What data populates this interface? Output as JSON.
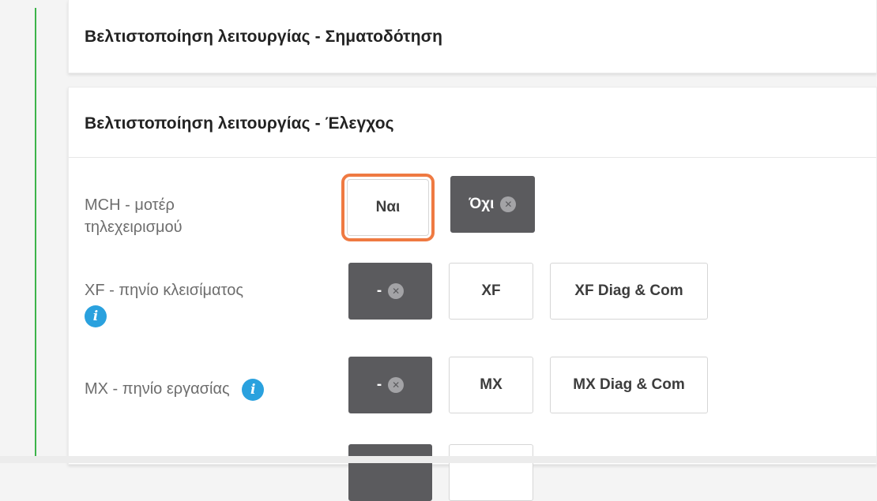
{
  "sections": {
    "signaling": {
      "title": "Βελτιστοποίηση λειτουργίας - Σηματοδότηση"
    },
    "control": {
      "title": "Βελτιστοποίηση λειτουργίας - Έλεγχος",
      "rows": [
        {
          "label_line1": "MCH - μοτέρ",
          "label_line2": "τηλεχειρισμού",
          "options": [
            "Ναι",
            "Όχι"
          ],
          "selected": "Ναι",
          "dark": "Όχι"
        },
        {
          "label": "XF - πηνίο κλεισίματος",
          "info_icon": "info-icon",
          "options": [
            "-",
            "XF",
            "XF Diag & Com"
          ],
          "dark": "-"
        },
        {
          "label": "MX - πηνίο εργασίας",
          "info_icon": "info-icon",
          "options": [
            "-",
            "MX",
            "MX Diag & Com"
          ],
          "dark": "-"
        }
      ]
    }
  },
  "icons": {
    "info": "i",
    "clear": "✕"
  },
  "colors": {
    "accent_green": "#3cb34a",
    "selected_outline": "#ef7a42",
    "info_blue": "#2aa1de",
    "dark_button": "#5b5b5e"
  }
}
